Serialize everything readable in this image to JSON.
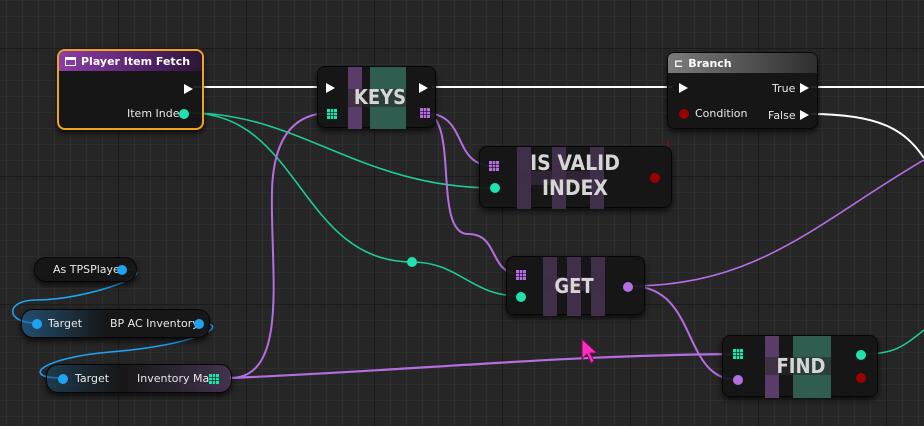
{
  "nodes": {
    "player_item_fetch": {
      "title": "Player Item Fetch",
      "pin_item_index": "Item Index"
    },
    "keys": {
      "title": "KEYS"
    },
    "branch": {
      "title": "Branch",
      "pin_condition": "Condition",
      "pin_true": "True",
      "pin_false": "False"
    },
    "is_valid_index": {
      "title_line1": "IS VALID",
      "title_line2": "INDEX"
    },
    "get": {
      "title": "GET"
    },
    "find": {
      "title": "FIND"
    },
    "as_tps_player": {
      "label": "As TPSPlayer"
    },
    "bp_ac_inventory": {
      "pin_target": "Target",
      "label": "BP AC Inventory"
    },
    "inventory_map": {
      "pin_target": "Target",
      "label": "Inventory Map"
    }
  },
  "colors": {
    "exec_wire": "#ffffff",
    "integer_pin": "#1fe3af",
    "object_pin": "#1ea3f2",
    "map_pin": "#b46ee0",
    "boolean_pin": "#9b0000",
    "selection_outline": "#f0a320",
    "cursor": "#ff2ec0"
  },
  "icons": {
    "function_icon": "function-icon",
    "branch_icon": "branch-icon",
    "cursor_icon": "mouse-cursor-icon"
  }
}
